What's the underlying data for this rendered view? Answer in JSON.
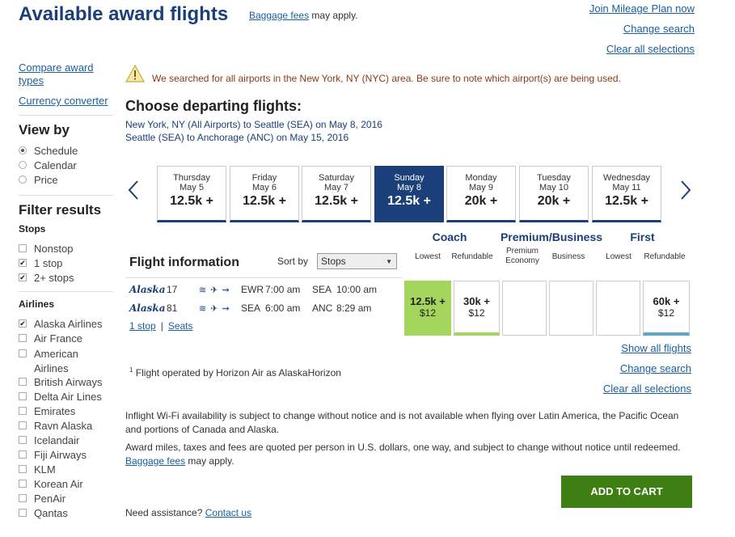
{
  "header": {
    "title": "Available award flights",
    "baggage_link": "Baggage fees",
    "baggage_suffix": " may apply.",
    "links": [
      "Join Mileage Plan now",
      "Change search",
      "Clear all selections"
    ]
  },
  "sidebar": {
    "links": [
      "Compare award types",
      "Currency converter"
    ],
    "view_by_heading": "View by",
    "view_by": [
      {
        "label": "Schedule",
        "selected": true
      },
      {
        "label": "Calendar",
        "selected": false
      },
      {
        "label": "Price",
        "selected": false
      }
    ],
    "filter_heading": "Filter results",
    "stops_heading": "Stops",
    "stops": [
      {
        "label": "Nonstop",
        "checked": false
      },
      {
        "label": "1 stop",
        "checked": true
      },
      {
        "label": "2+ stops",
        "checked": true
      }
    ],
    "airlines_heading": "Airlines",
    "airlines": [
      {
        "label": "Alaska Airlines",
        "checked": true
      },
      {
        "label": "Air France",
        "checked": false
      },
      {
        "label": "American Airlines",
        "checked": false
      },
      {
        "label": "British Airways",
        "checked": false
      },
      {
        "label": "Delta Air Lines",
        "checked": false
      },
      {
        "label": "Emirates",
        "checked": false
      },
      {
        "label": "Ravn Alaska",
        "checked": false
      },
      {
        "label": "Icelandair",
        "checked": false
      },
      {
        "label": "Fiji Airways",
        "checked": false
      },
      {
        "label": "KLM",
        "checked": false
      },
      {
        "label": "Korean Air",
        "checked": false
      },
      {
        "label": "PenAir",
        "checked": false
      },
      {
        "label": "Qantas",
        "checked": false
      }
    ]
  },
  "warning": "We searched for all airports in the New York, NY (NYC) area. Be sure to note which airport(s) are being used.",
  "main": {
    "heading": "Choose departing flights:",
    "routes": [
      "New York, NY (All Airports) to Seattle (SEA) on May 8, 2016",
      "Seattle (SEA) to Anchorage (ANC) on May 15, 2016"
    ],
    "dates": [
      {
        "dow": "Thursday",
        "md": "May 5",
        "price": "12.5k +"
      },
      {
        "dow": "Friday",
        "md": "May 6",
        "price": "12.5k +"
      },
      {
        "dow": "Saturday",
        "md": "May 7",
        "price": "12.5k +"
      },
      {
        "dow": "Sunday",
        "md": "May 8",
        "price": "12.5k +"
      },
      {
        "dow": "Monday",
        "md": "May 9",
        "price": "20k +"
      },
      {
        "dow": "Tuesday",
        "md": "May 10",
        "price": "20k +"
      },
      {
        "dow": "Wednesday",
        "md": "May 11",
        "price": "12.5k +"
      }
    ],
    "selected_date_index": 3,
    "fare_groups": [
      "Coach",
      "Premium/Business",
      "First"
    ],
    "fare_subs": [
      "Lowest",
      "Refundable",
      "Premium Economy",
      "Business",
      "Lowest",
      "Refundable"
    ],
    "flight_info_heading": "Flight information",
    "sort_label": "Sort by",
    "sort_value": "Stops",
    "flight": {
      "segments": [
        {
          "airline": "Alaska",
          "number": "17",
          "amenities": "≋ ✈ ⇝",
          "from": "EWR",
          "dep": "7:00 am",
          "to": "SEA",
          "arr": "10:00 am"
        },
        {
          "airline": "Alaska",
          "number": "81",
          "amenities": "≋ ✈ ⇝",
          "from": "SEA",
          "dep": "6:00 am",
          "to": "ANC",
          "arr": "8:29 am"
        }
      ],
      "stops_link": "1 stop",
      "seats_link": "Seats",
      "fares": [
        {
          "miles": "12.5k +",
          "tax": "$12"
        },
        {
          "miles": "30k +",
          "tax": "$12"
        },
        {
          "miles": "",
          "tax": ""
        },
        {
          "miles": "",
          "tax": ""
        },
        {
          "miles": "",
          "tax": ""
        },
        {
          "miles": "60k +",
          "tax": "$12"
        }
      ]
    },
    "right_links": [
      "Show all flights",
      "Change search",
      "Clear all selections"
    ],
    "footnote_mark": "1",
    "footnote": " Flight operated by Horizon Air as AlaskaHorizon",
    "wifi_note": "Inflight Wi-Fi availability is subject to change without notice and is not available when flying over Latin America, the Pacific Ocean and portions of Canada and Alaska.",
    "award_note": "Award miles, taxes and fees are quoted per person in U.S. dollars, one way, and subject to change without notice until redeemed.",
    "award_baggage_link": "Baggage fees",
    "award_baggage_suffix": " may apply.",
    "cart_button": "ADD TO CART",
    "assist_text": "Need assistance? ",
    "assist_link": "Contact us"
  },
  "colors": {
    "brand_navy": "#1b3f78",
    "link": "#1a5fa0",
    "lowest_fare": "#a4d65e",
    "cart_green": "#3f7e12",
    "warning_text": "#8a3a1a"
  }
}
